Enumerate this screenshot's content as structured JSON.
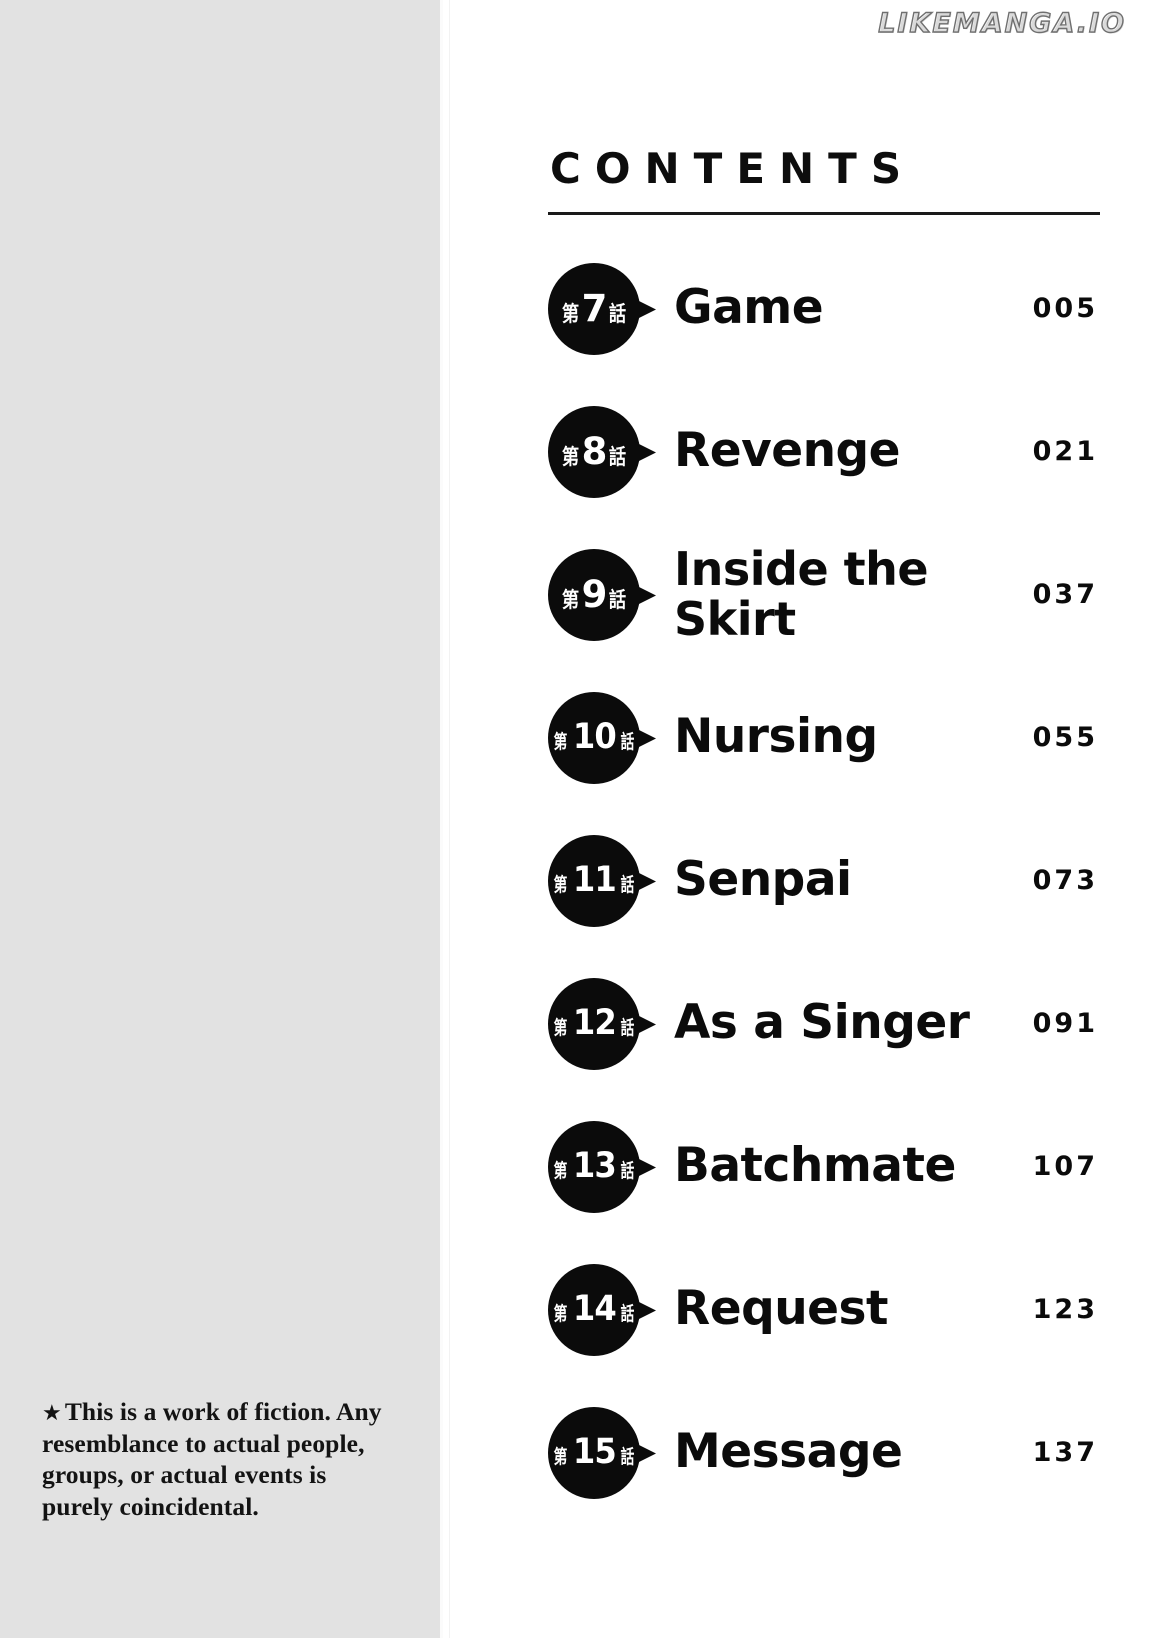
{
  "watermark": "LIKEMANGA.IO",
  "contents": {
    "heading": "CONTENTS",
    "chapters": [
      {
        "prefix": "第",
        "number": "7",
        "suffix": "話",
        "title": "Game",
        "page": "005"
      },
      {
        "prefix": "第",
        "number": "8",
        "suffix": "話",
        "title": "Revenge",
        "page": "021"
      },
      {
        "prefix": "第",
        "number": "9",
        "suffix": "話",
        "title": "Inside the\nSkirt",
        "page": "037"
      },
      {
        "prefix": "第",
        "number": "10",
        "suffix": "話",
        "title": "Nursing",
        "page": "055"
      },
      {
        "prefix": "第",
        "number": "11",
        "suffix": "話",
        "title": "Senpai",
        "page": "073"
      },
      {
        "prefix": "第",
        "number": "12",
        "suffix": "話",
        "title": "As a Singer",
        "page": "091"
      },
      {
        "prefix": "第",
        "number": "13",
        "suffix": "話",
        "title": "Batchmate",
        "page": "107"
      },
      {
        "prefix": "第",
        "number": "14",
        "suffix": "話",
        "title": "Request",
        "page": "123"
      },
      {
        "prefix": "第",
        "number": "15",
        "suffix": "話",
        "title": "Message",
        "page": "137"
      }
    ]
  },
  "disclaimer": {
    "star": "★",
    "text": "This is a work of fiction. Any resemblance to actual people, groups, or actual events is purely coincidental."
  },
  "colors": {
    "ink": "#0b0b0b",
    "panel": "#e2e2e2",
    "paper": "#ffffff"
  }
}
